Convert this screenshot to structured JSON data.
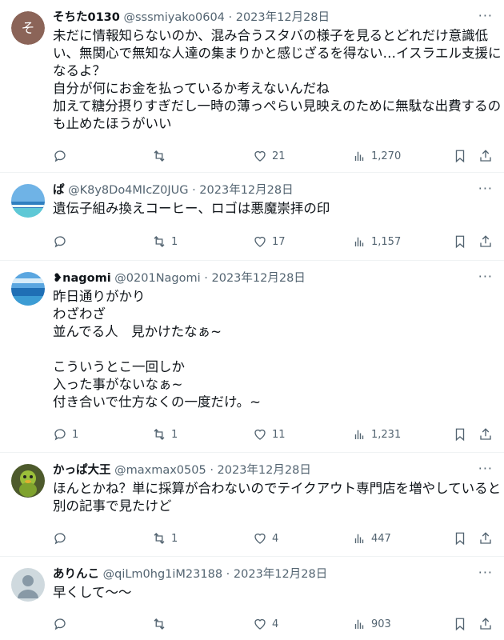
{
  "tweets": [
    {
      "name": "そちた0130",
      "handle": "@sssmiyako0604",
      "date": "2023年12月28日",
      "avatar_letter": "そ",
      "avatar_color": "#8b6458",
      "lines": [
        "未だに情報知らないのか、混み合うスタバの様子を見るとどれだけ意識低",
        "い、無関心で無知な人達の集まりかと感じざるを得ない…イスラエル支援に",
        "なるよ？",
        "自分が何にお金を払っているか考えないんだね",
        "加えて糖分摂りすぎだし一時の薄っぺらい見映えのために無駄な出費するの",
        "も止めたほうがいい"
      ],
      "replies": "",
      "retweets": "",
      "likes": "21",
      "views": "1,270"
    },
    {
      "name": "ぱ",
      "handle": "@K8y8Do4MIcZ0JUG",
      "date": "2023年12月28日",
      "avatar_letter": "",
      "avatar_color": "#4a90c8",
      "lines": [
        "遺伝子組み換えコーヒー、ロゴは悪魔崇拝の印"
      ],
      "replies": "",
      "retweets": "1",
      "likes": "17",
      "views": "1,157"
    },
    {
      "name": "❥nagomi",
      "handle": "@0201Nagomi",
      "date": "2023年12月28日",
      "avatar_letter": "",
      "avatar_color": "#3a86c6",
      "lines": [
        "昨日通りがかり",
        "わざわざ",
        "並んでる人　見かけたなぁ~",
        "",
        "こういうとこ一回しか",
        "入った事がないなぁ~",
        "付き合いで仕方なくの一度だけ。~"
      ],
      "replies": "1",
      "retweets": "1",
      "likes": "11",
      "views": "1,231"
    },
    {
      "name": "かっぱ大王",
      "handle": "@maxmax0505",
      "date": "2023年12月28日",
      "avatar_letter": "",
      "avatar_color": "#6b7d3a",
      "lines": [
        "ほんとかね？単に採算が合わないのでテイクアウト専門店を増やしていると",
        "別の記事で見たけど"
      ],
      "replies": "",
      "retweets": "1",
      "likes": "4",
      "views": "447"
    },
    {
      "name": "ありんこ",
      "handle": "@qiLm0hg1iM23188",
      "date": "2023年12月28日",
      "avatar_letter": "",
      "avatar_color": "#cfd9de",
      "lines": [
        "早くして〜〜"
      ],
      "replies": "",
      "retweets": "",
      "likes": "4",
      "views": "903"
    }
  ],
  "separator": "·",
  "more_glyph": "···"
}
